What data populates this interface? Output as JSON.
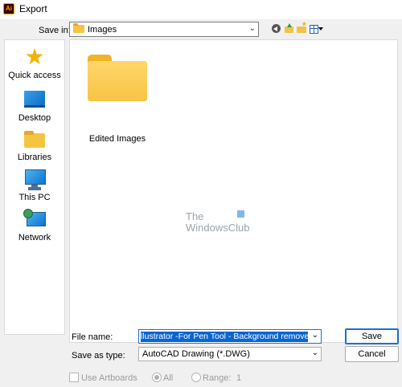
{
  "window": {
    "title": "Export",
    "app_icon": "Ai"
  },
  "location": {
    "label": "Save in:",
    "value": "Images",
    "toolbar": [
      "back-icon",
      "up-folder-icon",
      "new-folder-icon",
      "view-menu-icon"
    ]
  },
  "places": [
    {
      "label": "Quick access",
      "icon": "star-icon"
    },
    {
      "label": "Desktop",
      "icon": "desktop-icon"
    },
    {
      "label": "Libraries",
      "icon": "libraries-icon"
    },
    {
      "label": "This PC",
      "icon": "computer-icon"
    },
    {
      "label": "Network",
      "icon": "network-icon"
    }
  ],
  "files": [
    {
      "name": "Edited Images",
      "icon": "folder-icon"
    }
  ],
  "watermark": {
    "line1": "The",
    "line2": "WindowsClub"
  },
  "form": {
    "file_name_label": "File name:",
    "file_name_value": "llustrator -For Pen Tool - Background removed.dwg",
    "save_as_label": "Save as type:",
    "save_as_value": "AutoCAD Drawing (*.DWG)"
  },
  "buttons": {
    "save": "Save",
    "cancel": "Cancel"
  },
  "options": {
    "use_artboards": "Use Artboards",
    "all": "All",
    "range": "Range:",
    "range_value": "1"
  },
  "colors": {
    "accent": "#0a64d1",
    "folder": "#f7c444",
    "dialog_bg": "#f0f0f0"
  }
}
